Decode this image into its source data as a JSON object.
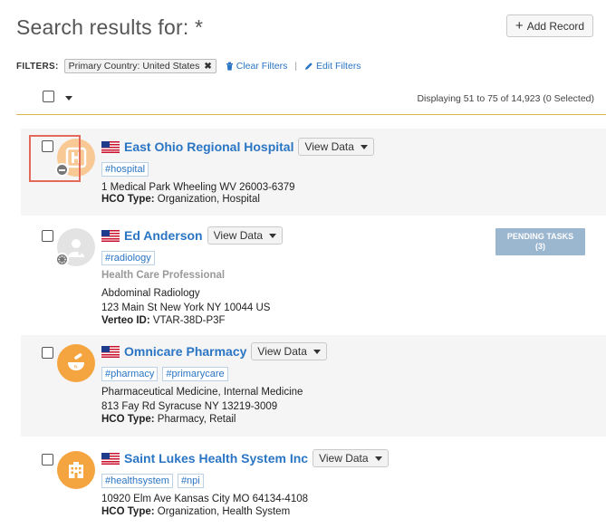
{
  "header": {
    "title": "Search results for: *",
    "add_record": "Add Record"
  },
  "filters": {
    "label": "FILTERS:",
    "chips": [
      "Primary Country: United States"
    ],
    "clear": "Clear Filters",
    "sep": "|",
    "edit": "Edit Filters"
  },
  "results_info": "Displaying 51 to 75 of 14,923 (0 Selected)",
  "colors": {
    "link": "#2a75c4",
    "accent_rule": "#d8b84a",
    "avatar_orange": "#f5a540",
    "pending": "#9bb6cf"
  },
  "records": [
    {
      "name": "East Ohio Regional Hospital",
      "view": "View Data",
      "tags": [
        "#hospital"
      ],
      "address": "1 Medical Park Wheeling WV 26003-6379",
      "type_label": "HCO Type:",
      "type_value": "Organization, Hospital",
      "icon": "hospital-icon"
    },
    {
      "name": "Ed Anderson",
      "view": "View Data",
      "tags": [
        "#radiology"
      ],
      "role": "Health Care Professional",
      "specialty": "Abdominal Radiology",
      "address": "123 Main St New York NY 10044 US",
      "id_label": "Verteo ID:",
      "id_value": "VTAR-38D-P3F",
      "pending_title": "PENDING TASKS",
      "pending_count": "(3)",
      "icon": "doctor-icon"
    },
    {
      "name": "Omnicare Pharmacy",
      "view": "View Data",
      "tags": [
        "#pharmacy",
        "#primarycare"
      ],
      "specialty": "Pharmaceutical Medicine, Internal Medicine",
      "address": "813 Fay Rd Syracuse NY 13219-3009",
      "type_label": "HCO Type:",
      "type_value": "Pharmacy, Retail",
      "icon": "pharmacy-icon"
    },
    {
      "name": "Saint Lukes Health System Inc",
      "view": "View Data",
      "tags": [
        "#healthsystem",
        "#npi"
      ],
      "address": "10920 Elm Ave Kansas City MO 64134-4108",
      "type_label": "HCO Type:",
      "type_value": "Organization, Health System",
      "icon": "building-icon"
    }
  ]
}
